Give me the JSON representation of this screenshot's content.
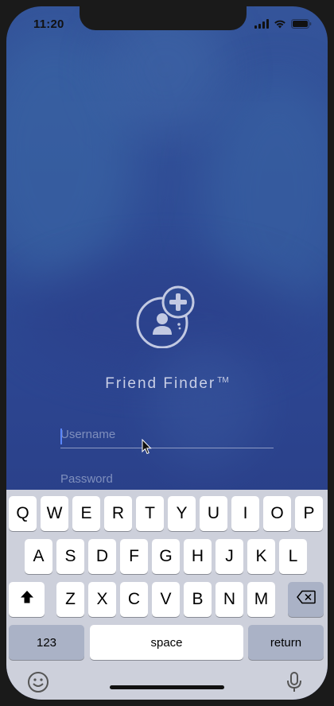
{
  "status_bar": {
    "time": "11:20"
  },
  "brand": {
    "name": "Friend Finder",
    "trademark": "TM"
  },
  "login": {
    "username_placeholder": "Username",
    "password_placeholder": "Password"
  },
  "keyboard": {
    "row1": [
      "Q",
      "W",
      "E",
      "R",
      "T",
      "Y",
      "U",
      "I",
      "O",
      "P"
    ],
    "row2": [
      "A",
      "S",
      "D",
      "F",
      "G",
      "H",
      "J",
      "K",
      "L"
    ],
    "row3": [
      "Z",
      "X",
      "C",
      "V",
      "B",
      "N",
      "M"
    ],
    "numbers_label": "123",
    "space_label": "space",
    "return_label": "return"
  },
  "colors": {
    "background": "#2f4c95",
    "brand_text": "#c9cfe6",
    "keyboard_bg": "#cdd0db",
    "key_dark": "#aab2c6"
  }
}
